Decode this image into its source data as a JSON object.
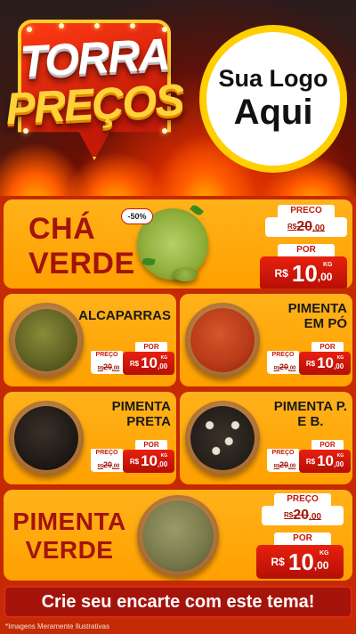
{
  "header": {
    "logo_line1": "TORRA",
    "logo_line2": "PREÇOS",
    "brand_line1": "Sua Logo",
    "brand_line2": "Aqui"
  },
  "featured_top": {
    "name_line1": "CHÁ",
    "name_line2": "VERDE",
    "discount": "-50%",
    "preco_label": "PRECO",
    "old_currency": "R$",
    "old_int": "20",
    "old_cents": ",00",
    "por_label": "POR",
    "new_currency": "R$",
    "new_int": "10",
    "new_cents": ",00",
    "unit": "KG"
  },
  "grid_items": [
    {
      "name": "ALCAPARRAS",
      "preco_label": "PREÇO",
      "old_currency": "R$",
      "old_int": "20",
      "old_cents": ",00",
      "por_label": "POR",
      "new_currency": "R$",
      "new_int": "10",
      "new_cents": ",00",
      "unit": "KG"
    },
    {
      "name": "PIMENTA EM PÓ",
      "name_line1": "PIMENTA",
      "name_line2": "EM PÓ",
      "preco_label": "PREÇO",
      "old_currency": "R$",
      "old_int": "20",
      "old_cents": ",00",
      "por_label": "POR",
      "new_currency": "R$",
      "new_int": "10",
      "new_cents": ",00",
      "unit": "KG"
    },
    {
      "name": "PIMENTA PRETA",
      "name_line1": "PIMENTA",
      "name_line2": "PRETA",
      "preco_label": "PREÇO",
      "old_currency": "R$",
      "old_int": "20",
      "old_cents": ",00",
      "por_label": "POR",
      "new_currency": "R$",
      "new_int": "10",
      "new_cents": ",00",
      "unit": "KG"
    },
    {
      "name": "PIMENTA P. E B.",
      "name_line1": "PIMENTA P.",
      "name_line2": "E B.",
      "preco_label": "PREÇO",
      "old_currency": "R$",
      "old_int": "20",
      "old_cents": ",00",
      "por_label": "POR",
      "new_currency": "R$",
      "new_int": "10",
      "new_cents": ",00",
      "unit": "KG"
    }
  ],
  "featured_bottom": {
    "name_line1": "PIMENTA",
    "name_line2": "VERDE",
    "preco_label": "PREÇO",
    "old_currency": "R$",
    "old_int": "20",
    "old_cents": ",00",
    "por_label": "POR",
    "new_currency": "R$",
    "new_int": "10",
    "new_cents": ",00",
    "unit": "KG"
  },
  "cta": "Crie seu encarte com este tema!",
  "footnote": "*Imagens Meramente Ilustrativas",
  "colors": {
    "panel": "#ffa70f",
    "price_red": "#c41a08",
    "title_red": "#a3130b",
    "brand_ring": "#ffcf00"
  }
}
